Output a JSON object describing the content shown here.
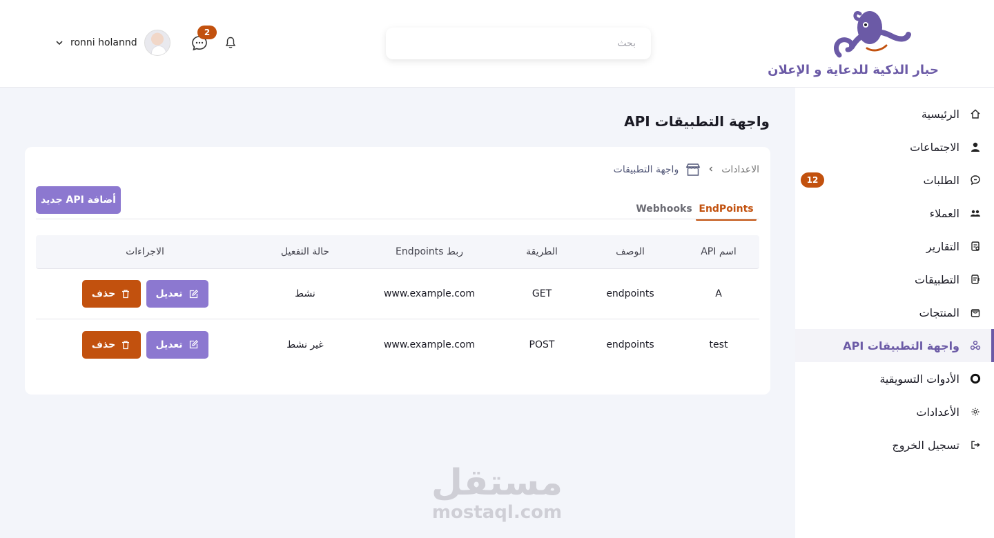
{
  "header": {
    "user_name": "ronni holannd",
    "chat_count": "2",
    "search_placeholder": "بحث",
    "logo_text": "حبار الذكية للدعاية و الإعلان"
  },
  "sidebar": {
    "items": [
      {
        "label": "الرئيسية",
        "icon": "home-icon"
      },
      {
        "label": "الاجتماعات",
        "icon": "person-icon"
      },
      {
        "label": "الطلبات",
        "icon": "chat-icon",
        "badge": "12"
      },
      {
        "label": "العملاء",
        "icon": "users-icon"
      },
      {
        "label": "التقارير",
        "icon": "report-icon"
      },
      {
        "label": "التطبيقات",
        "icon": "app-icon"
      },
      {
        "label": "المنتجات",
        "icon": "bag-icon"
      },
      {
        "label": "واجهة التطبيقات API",
        "icon": "api-icon",
        "active": true
      },
      {
        "label": "الأدوات التسويقية",
        "icon": "circle-icon"
      },
      {
        "label": "الأعدادات",
        "icon": "gear-icon"
      },
      {
        "label": "تسجيل الخروج",
        "icon": "logout-icon"
      }
    ]
  },
  "main": {
    "title": "واجهة التطبيقات API",
    "breadcrumb": {
      "root": "الاعدادات",
      "current": "واجهة التطبيقات"
    },
    "add_button": "أضافة API جديد",
    "tabs": [
      {
        "label": "EndPoints",
        "active": true
      },
      {
        "label": "Webhooks",
        "active": false
      }
    ],
    "table": {
      "headers": {
        "name": "API اسم",
        "desc": "الوصف",
        "method": "الطريقة",
        "url": "Endpoints ربط",
        "status": "حالة التفعيل",
        "actions": "الاجراءات"
      },
      "rows": [
        {
          "name": "A",
          "desc": "endpoints",
          "method": "GET",
          "url": "www.example.com",
          "status": "نشط"
        },
        {
          "name": "test",
          "desc": "endpoints",
          "method": "POST",
          "url": "www.example.com",
          "status": "غير نشط"
        }
      ],
      "edit_label": "تعديل",
      "delete_label": "حذف"
    }
  },
  "watermark": {
    "ar": "مستقل",
    "en": "mostaql.com"
  },
  "colors": {
    "accent": "#8c78d0",
    "brand": "#6b5aa6",
    "danger": "#c2510e",
    "background": "#f3f5fa"
  }
}
